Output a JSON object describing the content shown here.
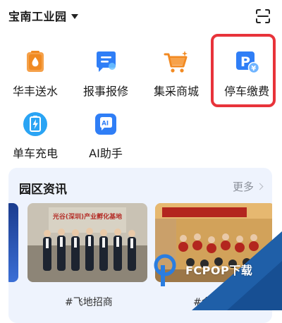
{
  "header": {
    "park_name": "宝南工业园",
    "scan_icon": "scan-icon"
  },
  "apps": [
    {
      "label": "华丰送水",
      "icon": "water-delivery-icon",
      "color": "#f28a22"
    },
    {
      "label": "报事报修",
      "icon": "report-repair-icon",
      "color": "#2f7ef6"
    },
    {
      "label": "集采商城",
      "icon": "shopping-cart-icon",
      "color": "#f28a22"
    },
    {
      "label": "停车缴费",
      "icon": "parking-payment-icon",
      "color": "#2f7ef6"
    },
    {
      "label": "单车充电",
      "icon": "bike-charging-icon",
      "color": "#2aa4f4"
    },
    {
      "label": "AI助手",
      "icon": "ai-assistant-icon",
      "color": "#2f7ef6"
    }
  ],
  "highlight_color": "#e8333a",
  "news": {
    "title": "园区资讯",
    "more_label": "更多",
    "items": [
      {
        "caption": "#飞地招商",
        "banner_text": "光谷(深圳)产业孵化基地"
      },
      {
        "caption": "#企业营销"
      }
    ]
  },
  "watermark": {
    "text": "FCPOP下载",
    "brand": "FCPOP"
  }
}
